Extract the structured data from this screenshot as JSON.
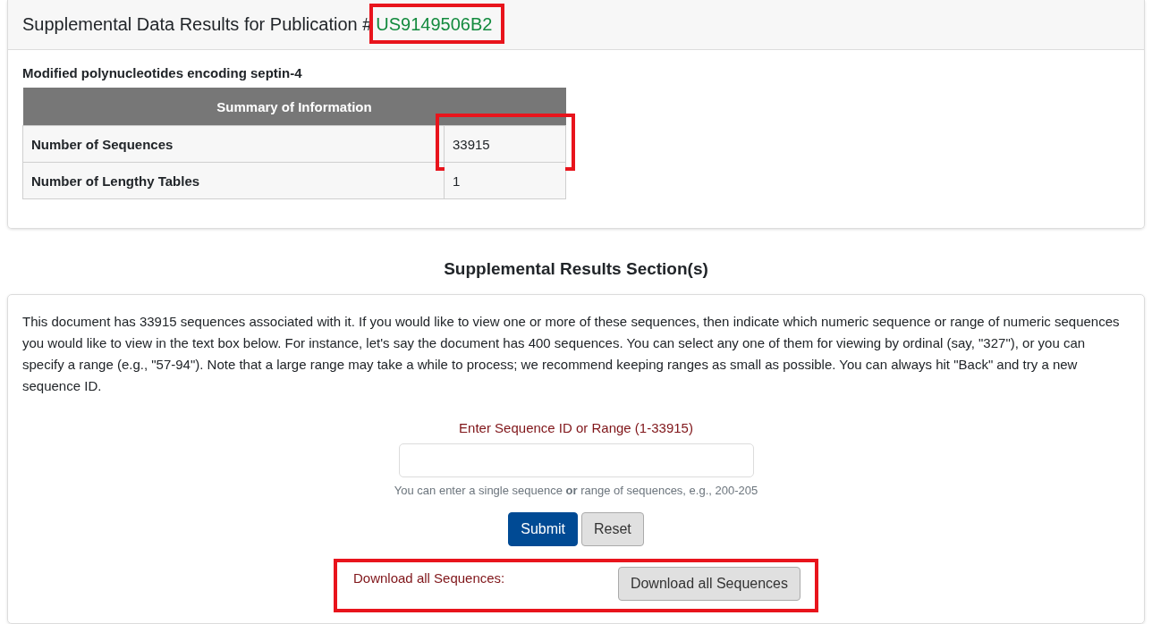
{
  "header": {
    "title": "Supplemental Data Results for Publication #",
    "publication_id": "US9149506B2",
    "highlighted": true
  },
  "summary": {
    "subtitle": "Modified polynucleotides encoding septin-4",
    "table_title": "Summary of Information",
    "rows": [
      {
        "label": "Number of Sequences",
        "value": "33915",
        "highlighted": true
      },
      {
        "label": "Number of Lengthy Tables",
        "value": "1",
        "highlighted": false
      }
    ]
  },
  "section_heading": "Supplemental Results Section(s)",
  "results": {
    "description": "This document has 33915 sequences associated with it. If you would like to view one or more of these sequences, then indicate which numeric sequence or range of numeric sequences you would like to view in the text box below. For instance, let's say the document has 400 sequences. You can select any one of them for viewing by ordinal (say, \"327\"), or you can specify a range (e.g., \"57-94\"). Note that a large range may take a while to process; we recommend keeping ranges as small as possible. You can always hit \"Back\" and try a new sequence ID.",
    "field_label": "Enter Sequence ID or Range (1-33915)",
    "help_text": "You can enter a single sequence **or** range of sequences, e.g., 200-205",
    "buttons": [
      {
        "label": "Submit",
        "kind": "primary"
      },
      {
        "label": "Reset",
        "kind": "secondary"
      }
    ],
    "download": {
      "label": "Download all Sequences:",
      "button": "Download all Sequences",
      "highlighted": true
    }
  }
}
